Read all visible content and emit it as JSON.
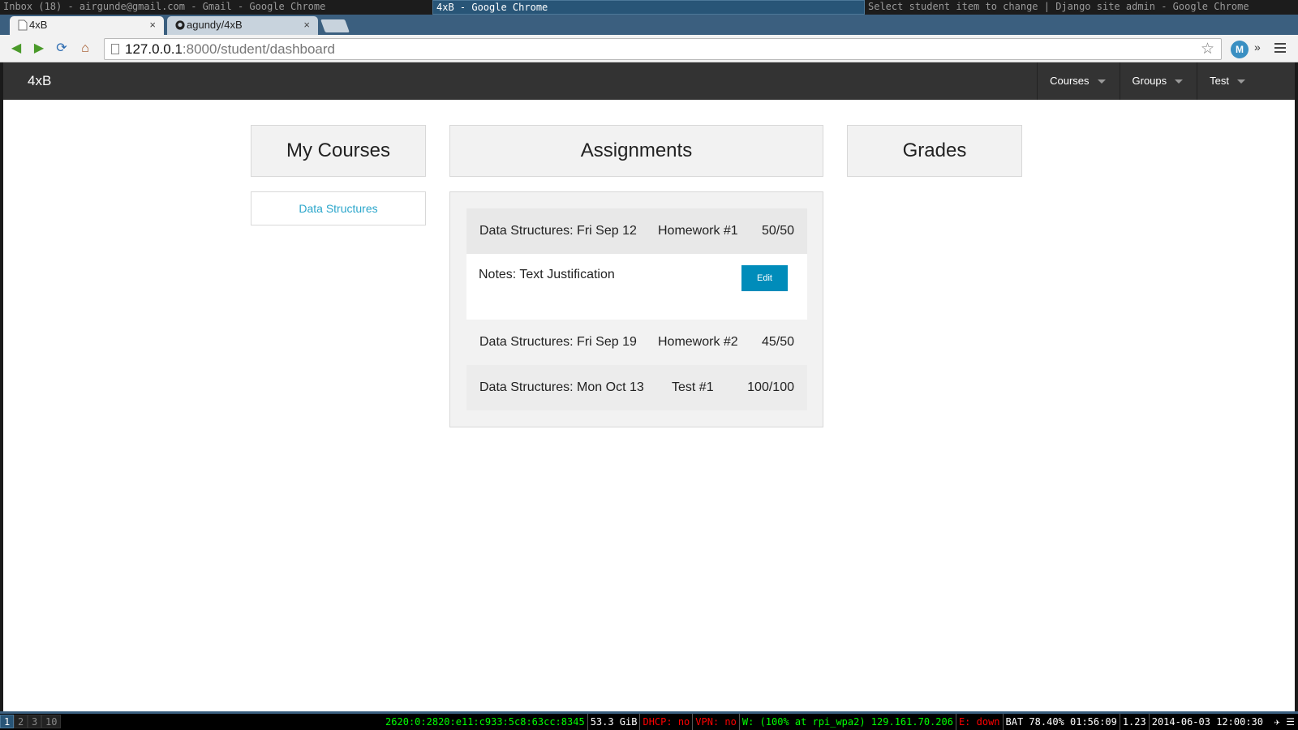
{
  "wm": {
    "windows": [
      "Inbox (18) - airgunde@gmail.com - Gmail - Google Chrome",
      "4xB - Google Chrome",
      "Select student item to change | Django site admin - Google Chrome"
    ]
  },
  "browser": {
    "tabs": [
      {
        "label": "4xB",
        "close": "×"
      },
      {
        "label": "agundy/4xB",
        "close": "×"
      }
    ],
    "url_host": "127.0.0.1",
    "url_path": ":8000/student/dashboard",
    "overflow": "»"
  },
  "navbar": {
    "brand": "4xB",
    "items": [
      "Courses",
      "Groups",
      "Test"
    ]
  },
  "panels": {
    "courses_title": "My Courses",
    "assignments_title": "Assignments",
    "grades_title": "Grades"
  },
  "courses": [
    "Data Structures"
  ],
  "assignments": [
    {
      "date": "Data Structures: Fri Sep 12",
      "title": "Homework #1",
      "score": "50/50"
    },
    {
      "date": "Data Structures: Fri Sep 19",
      "title": "Homework #2",
      "score": "45/50"
    },
    {
      "date": "Data Structures: Mon Oct 13",
      "title": "Test #1",
      "score": "100/100"
    }
  ],
  "notes": {
    "text": "Notes: Text Justification",
    "edit_label": "Edit"
  },
  "statusbar": {
    "workspaces": [
      "1",
      "2",
      "3",
      "10"
    ],
    "ipv6": "2620:0:2820:e11:c933:5c8:63cc:8345",
    "disk": "53.3 GiB",
    "dhcp": "DHCP: no",
    "vpn": "VPN: no",
    "wifi": "W: (100% at rpi_wpa2) 129.161.70.206",
    "eth": "E: down",
    "battery": "BAT 78.40% 01:56:09",
    "load": "1.23",
    "datetime": "2014-06-03 12:00:30"
  }
}
